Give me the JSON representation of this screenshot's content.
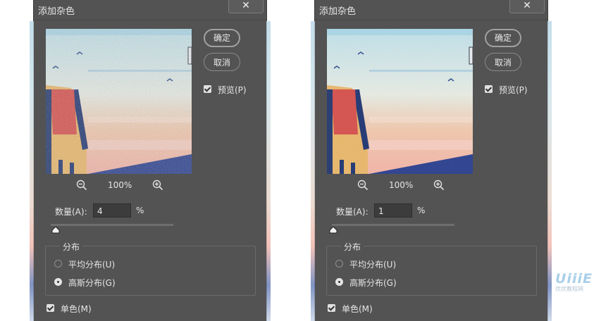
{
  "dialogs": [
    {
      "title": "添加杂色",
      "close_label": "✕",
      "ok_label": "确定",
      "cancel_label": "取消",
      "preview_label": "预览(P)",
      "preview_checked": true,
      "zoom_out_icon": "zoom-out-icon",
      "zoom_in_icon": "zoom-in-icon",
      "zoom_level": "100%",
      "amount_label": "数量(A):",
      "amount_value": "4",
      "amount_unit": "%",
      "amount_slider_fraction": 0.04,
      "distribution_legend": "分布",
      "uniform_label": "平均分布(U)",
      "gaussian_label": "高斯分布(G)",
      "selected_distribution": "gaussian",
      "mono_label": "单色(M)",
      "mono_checked": true
    },
    {
      "title": "添加杂色",
      "close_label": "✕",
      "ok_label": "确定",
      "cancel_label": "取消",
      "preview_label": "预览(P)",
      "preview_checked": true,
      "zoom_out_icon": "zoom-out-icon",
      "zoom_in_icon": "zoom-in-icon",
      "zoom_level": "100%",
      "amount_label": "数量(A):",
      "amount_value": "1",
      "amount_unit": "%",
      "amount_slider_fraction": 0.01,
      "distribution_legend": "分布",
      "uniform_label": "平均分布(U)",
      "gaussian_label": "高斯分布(G)",
      "selected_distribution": "gaussian",
      "mono_label": "单色(M)",
      "mono_checked": true
    }
  ],
  "watermark": {
    "logo_text": "UiiiE",
    "sub_text": "优优教程网"
  }
}
